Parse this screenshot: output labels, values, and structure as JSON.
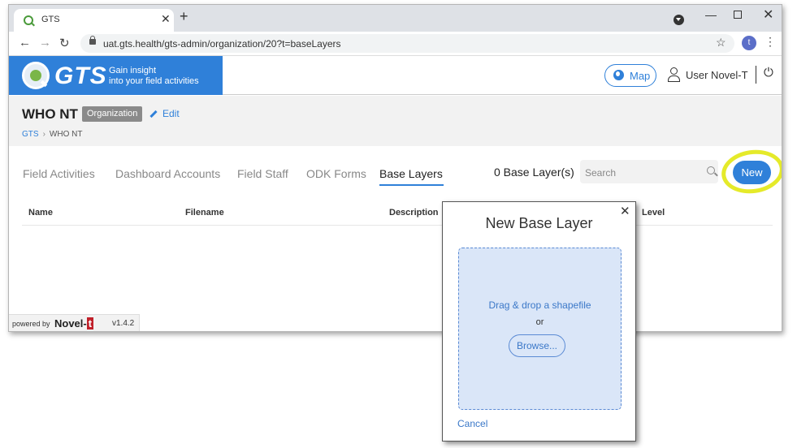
{
  "browser": {
    "tab_title": "GTS",
    "url": "uat.gts.health/gts-admin/organization/20?t=baseLayers",
    "avatar_letter": "t"
  },
  "header": {
    "logo_text": "GTS",
    "tagline_line1": "Gain insight",
    "tagline_line2": "into your field activities",
    "map_label": "Map",
    "user_name": "User Novel-T",
    "brand_color": "#2f80d9"
  },
  "org": {
    "name": "WHO NT",
    "badge": "Organization",
    "edit_label": "Edit",
    "breadcrumb_home": "GTS",
    "breadcrumb_current": "WHO NT"
  },
  "tabs": [
    {
      "label": "Field Activities"
    },
    {
      "label": "Dashboard Accounts"
    },
    {
      "label": "Field Staff"
    },
    {
      "label": "ODK Forms"
    },
    {
      "label": "Base Layers",
      "active": true
    }
  ],
  "toolbar": {
    "count_label": "0 Base Layer(s)",
    "search_placeholder": "Search",
    "new_label": "New"
  },
  "table": {
    "columns": [
      "Name",
      "Filename",
      "Description",
      "Level"
    ]
  },
  "footer": {
    "powered_by": "powered by",
    "brand_main": "Novel-",
    "brand_t": "t",
    "version": "v1.4.2"
  },
  "dialog": {
    "title": "New Base Layer",
    "drop_text": "Drag & drop a shapefile",
    "or_text": "or",
    "browse_label": "Browse...",
    "cancel_label": "Cancel"
  }
}
